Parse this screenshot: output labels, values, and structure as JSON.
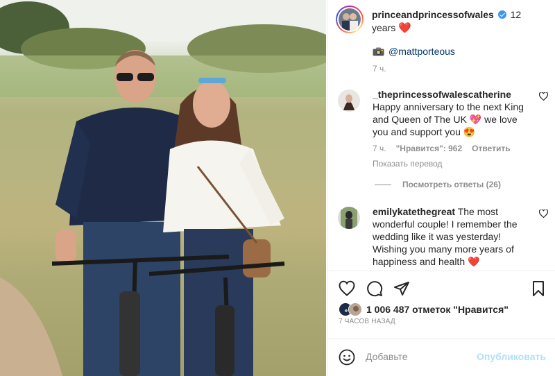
{
  "post": {
    "username": "princeandprincessofwales",
    "caption_text": "12 years",
    "credit_mention": "@mattporteous",
    "time_ago": "7 ч."
  },
  "comments": [
    {
      "username": "_theprincessofwalescatherine",
      "text": "Happy anniversary to the next King and Queen of The UK 💖 we love you and support you 😍",
      "time": "7 ч.",
      "likes": "\"Нравится\": 962",
      "reply_label": "Ответить",
      "translate_label": "Показать перевод"
    },
    {
      "username": "emilykatethegreat",
      "text": "The most wonderful couple! I remember the wedding like it was yesterday! Wishing you many more years of happiness and health ❤️"
    }
  ],
  "view_replies_label": "Посмотреть ответы (26)",
  "likes_label": "1 006 487 отметок \"Нравится\"",
  "posted_time": "7 ЧАСОВ НАЗАД",
  "comment_box": {
    "placeholder": "Добавьте",
    "post_label": "Опубликовать"
  },
  "icons": {
    "like": "heart-icon",
    "comment": "comment-bubble-icon",
    "share": "paper-plane-icon",
    "save": "bookmark-icon",
    "emoji": "smiley-icon",
    "credit": "camera-icon",
    "verified": "verified-badge-icon"
  },
  "colors": {
    "link": "#00376b",
    "muted": "#8e8e8e",
    "verified": "#3897f0",
    "post_button_disabled": "#b2dffc",
    "heart": "#e0245e"
  }
}
